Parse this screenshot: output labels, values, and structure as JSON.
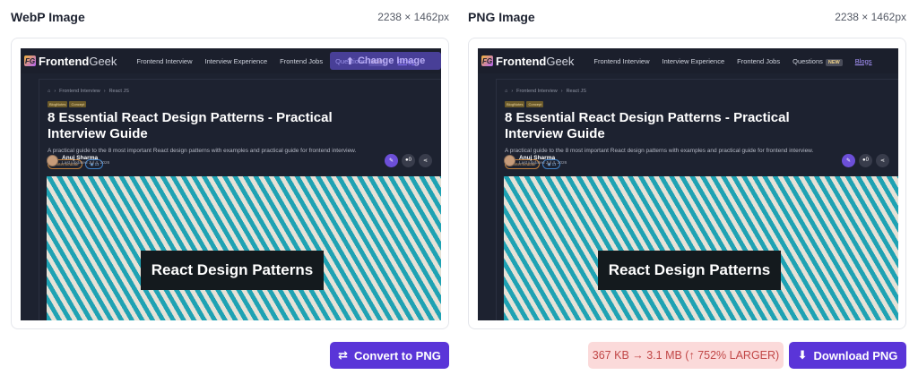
{
  "panels": [
    {
      "title": "WebP Image",
      "dims": "2238 × 1462px",
      "show_change_image": true
    },
    {
      "title": "PNG Image",
      "dims": "2238 × 1462px",
      "show_change_image": false
    }
  ],
  "preview": {
    "logo_mark": "FG",
    "logo_bold": "Frontend",
    "logo_thin": "Geek",
    "nav": [
      "Frontend Interview",
      "Interview Experience",
      "Frontend Jobs",
      "Questions",
      "Blogs"
    ],
    "nav_new_badge": "NEW",
    "change_image_label": "Change Image",
    "breadcrumb": [
      "Frontend Interview",
      "React JS"
    ],
    "tags": [
      "BlogNotes",
      "Concept"
    ],
    "title": "8 Essential React Design Patterns - Practical Interview Guide",
    "subtitle": "A practical guide to the 8 most important React design patterns with examples and practical guide for frontend interview.",
    "pills": [
      "Intermediate",
      "11"
    ],
    "author_name": "Anuj Sharma",
    "author_date": "Last Updated Jul 4, 2026",
    "comment_count": "0",
    "hero_label": "React Design Patterns"
  },
  "actions": {
    "convert_label": "Convert to PNG",
    "size_info": "367 KB → 3.1 MB (↑ 752% LARGER)",
    "download_label": "Download PNG"
  },
  "colors": {
    "accent": "#5a35d8",
    "badge_bg": "#fbdada",
    "badge_text": "#c14747"
  },
  "icons": {
    "convert": "swap-arrows-icon",
    "download": "download-icon",
    "change_image": "upload-icon"
  }
}
